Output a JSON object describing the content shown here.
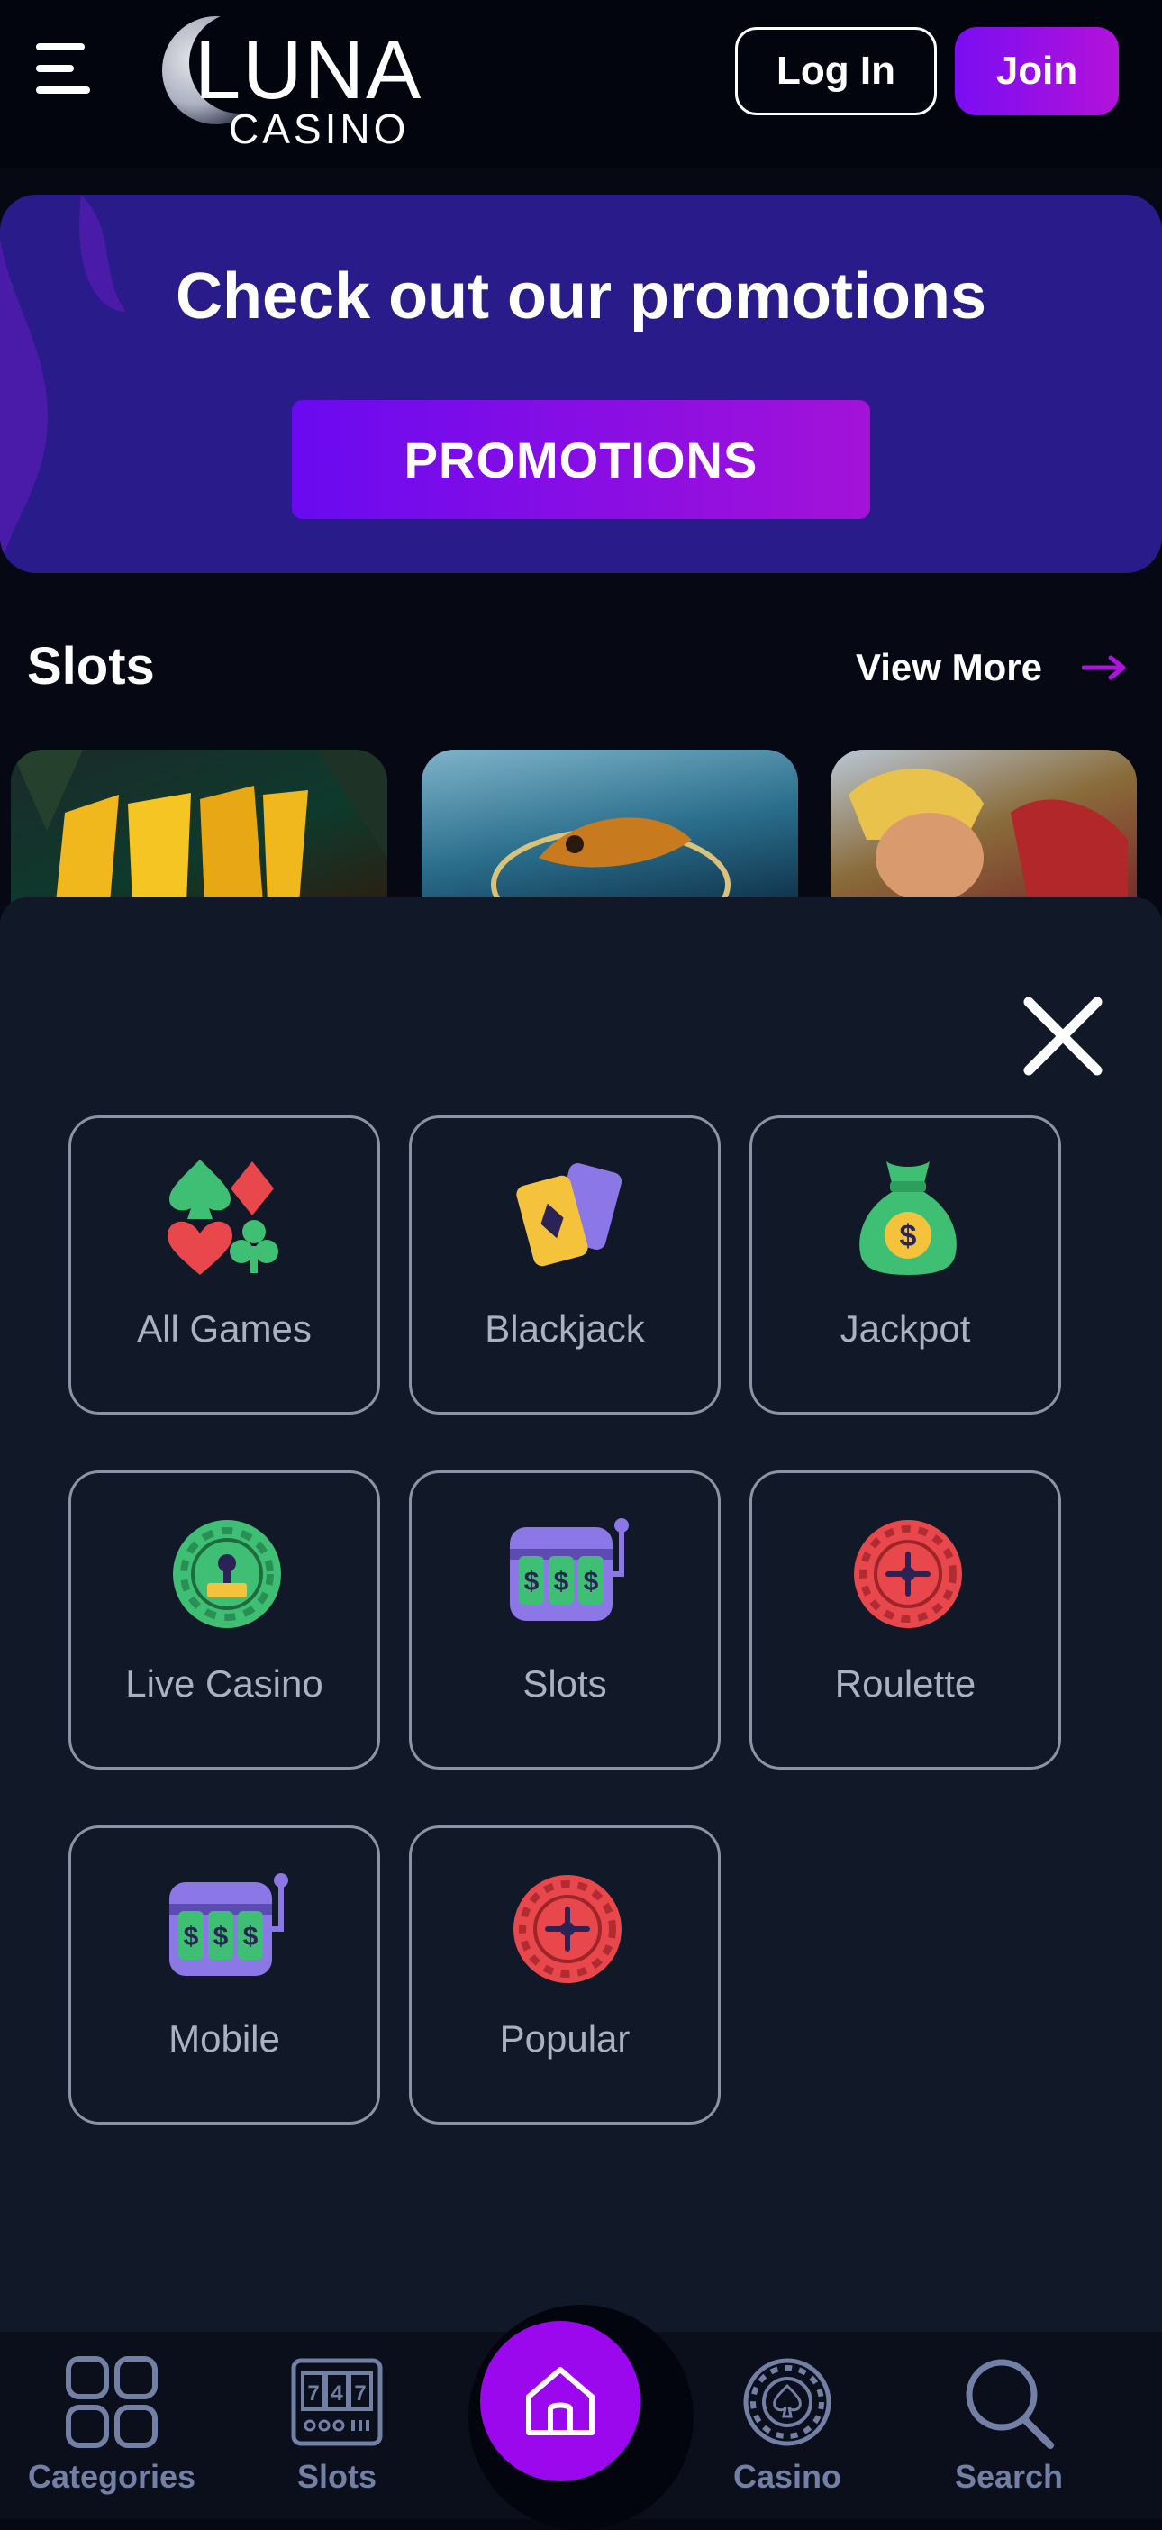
{
  "header": {
    "logo_main": "LUNA",
    "logo_sub": "CASINO",
    "login_label": "Log In",
    "join_label": "Join"
  },
  "promo": {
    "title": "Check out our promotions",
    "button_label": "PROMOTIONS"
  },
  "slots_section": {
    "title": "Slots",
    "view_more_label": "View More"
  },
  "categories": [
    {
      "label": "All Games",
      "icon": "card-suits-icon"
    },
    {
      "label": "Blackjack",
      "icon": "playing-cards-icon"
    },
    {
      "label": "Jackpot",
      "icon": "money-bag-icon"
    },
    {
      "label": "Live Casino",
      "icon": "live-chip-icon"
    },
    {
      "label": "Slots",
      "icon": "slot-machine-icon"
    },
    {
      "label": "Roulette",
      "icon": "roulette-icon"
    },
    {
      "label": "Mobile",
      "icon": "slot-machine-icon"
    },
    {
      "label": "Popular",
      "icon": "roulette-icon"
    }
  ],
  "bottom_nav": {
    "categories_label": "Categories",
    "slots_label": "Slots",
    "casino_label": "Casino",
    "search_label": "Search"
  },
  "colors": {
    "accent_purple": "#9b08ee",
    "promo_bg": "#2a1b8a",
    "panel_bg": "#111827",
    "nav_text": "#7380a6"
  }
}
